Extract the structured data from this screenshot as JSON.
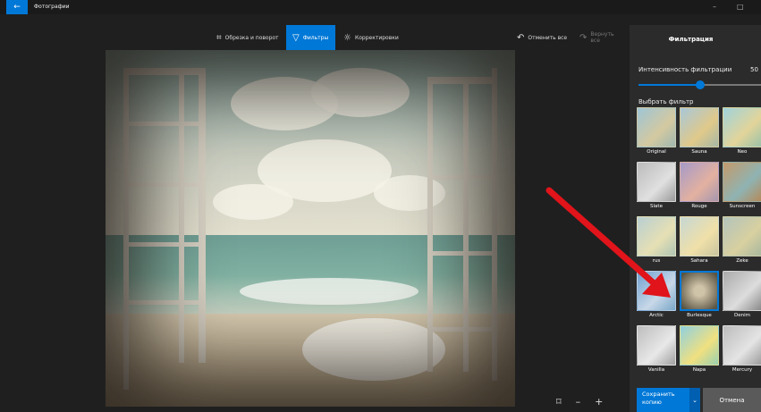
{
  "titlebar": {
    "back_icon": "←",
    "title": "Фотографии",
    "minimize": "–",
    "maximize": "□"
  },
  "toolbar": {
    "crop_label": "Обрезка и поворот",
    "filters_label": "Фильтры",
    "adjust_label": "Корректировки",
    "undo_all_label": "Отменить все",
    "redo_all_label": "Вернуть все"
  },
  "zoom": {
    "fit_icon": "⌑",
    "minus": "–",
    "plus": "+"
  },
  "panel": {
    "title": "Фильтрация",
    "intensity_label": "Интенсивность фильтрации",
    "intensity_value": "50",
    "intensity_fraction": 0.5,
    "choose_label": "Выбрать фильтр",
    "filters": [
      {
        "name": "Original"
      },
      {
        "name": "Sauna"
      },
      {
        "name": "Neo"
      },
      {
        "name": "Slate"
      },
      {
        "name": "Rouge"
      },
      {
        "name": "Sunscreen"
      },
      {
        "name": "rus"
      },
      {
        "name": "Sahara"
      },
      {
        "name": "Zeke"
      },
      {
        "name": "Arctic"
      },
      {
        "name": "Burlesque"
      },
      {
        "name": "Denim"
      },
      {
        "name": "Vanilla"
      },
      {
        "name": "Napa"
      },
      {
        "name": "Mercury"
      }
    ],
    "selected_filter": "Burlesque",
    "save_label": "Сохранить копию",
    "save_dropdown_icon": "⌄",
    "cancel_label": "Отмена"
  },
  "colors": {
    "accent": "#0078d7",
    "arrow": "#e0141a"
  }
}
